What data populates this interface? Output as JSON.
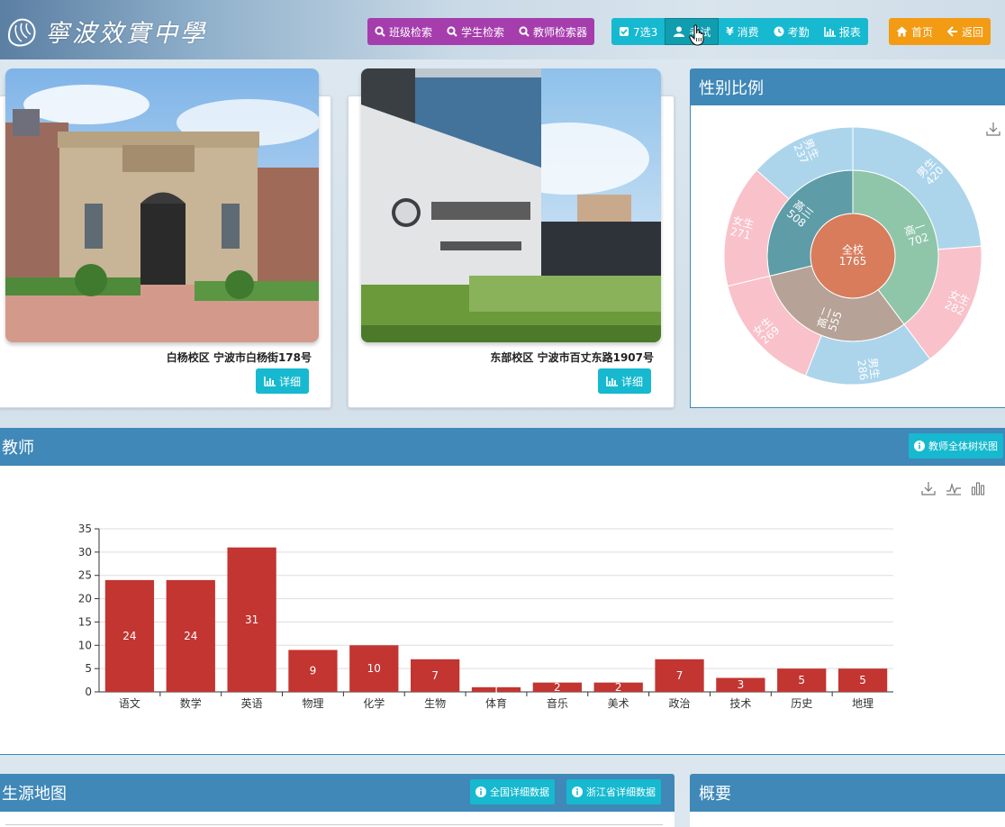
{
  "app": {
    "logo_text": "寧波效實中學"
  },
  "toolbar": {
    "search_group": [
      {
        "label": "班级检索",
        "icon": "search-icon"
      },
      {
        "label": "学生检索",
        "icon": "search-icon"
      },
      {
        "label": "教师检索器",
        "icon": "search-icon"
      }
    ],
    "func_group": [
      {
        "label": "7选3",
        "icon": "checkbox-icon"
      },
      {
        "label": "考试",
        "icon": "exam-icon"
      },
      {
        "label": "消费",
        "icon": "yen-icon"
      },
      {
        "label": "考勤",
        "icon": "clock-icon"
      },
      {
        "label": "报表",
        "icon": "bar-chart-icon"
      }
    ],
    "nav_group": [
      {
        "label": "首页",
        "icon": "home-icon"
      },
      {
        "label": "返回",
        "icon": "arrow-left-icon"
      }
    ]
  },
  "campuses": [
    {
      "caption": "白杨校区 宁波市白杨街178号",
      "detail_label": "详细"
    },
    {
      "caption": "东部校区 宁波市百丈东路1907号",
      "detail_label": "详细"
    }
  ],
  "gender_panel": {
    "title": "性别比例",
    "chart_data": {
      "type": "sunburst",
      "center": {
        "label": "全校",
        "value": 1765
      },
      "inner": [
        {
          "label": "高一",
          "value": 702,
          "color": "#8fc6a9"
        },
        {
          "label": "高二",
          "value": 555,
          "color": "#b6a296"
        },
        {
          "label": "高三",
          "value": 508,
          "color": "#5e9ca7"
        }
      ],
      "outer": [
        {
          "label": "男生",
          "value": 420,
          "parent": "高一",
          "color": "#acd5ec"
        },
        {
          "label": "女生",
          "value": 282,
          "parent": "高一",
          "color": "#f9c1c9"
        },
        {
          "label": "男生",
          "value": 286,
          "parent": "高二",
          "color": "#acd5ec"
        },
        {
          "label": "女生",
          "value": 269,
          "parent": "高二",
          "color": "#f9c1c9"
        },
        {
          "label": "女生",
          "value": 271,
          "parent": "高三",
          "color": "#f9c1c9"
        },
        {
          "label": "男生",
          "value": 237,
          "parent": "高三",
          "color": "#acd5ec"
        }
      ],
      "center_color": "#d87c5c"
    }
  },
  "teacher_panel": {
    "title": "教师",
    "tree_button_label": "教师全体树状图",
    "chart_data": {
      "type": "bar",
      "categories": [
        "语文",
        "数学",
        "英语",
        "物理",
        "化学",
        "生物",
        "体育",
        "音乐",
        "美术",
        "政治",
        "技术",
        "历史",
        "地理"
      ],
      "values": [
        24,
        24,
        31,
        9,
        10,
        7,
        1,
        2,
        2,
        7,
        3,
        5,
        5
      ],
      "ylim": [
        0,
        35
      ],
      "yticks": [
        0,
        5,
        10,
        15,
        20,
        25,
        30,
        35
      ],
      "bar_color": "#c23531",
      "grid": true
    }
  },
  "map_panel": {
    "title": "生源地图",
    "national_label": "全国详细数据",
    "zhejiang_label": "浙江省详细数据"
  },
  "overview_panel": {
    "title": "概要"
  },
  "colors": {
    "accent": "#3f88b8",
    "teal": "#16b9cf",
    "purple": "#a63dad",
    "orange": "#f29b13"
  }
}
